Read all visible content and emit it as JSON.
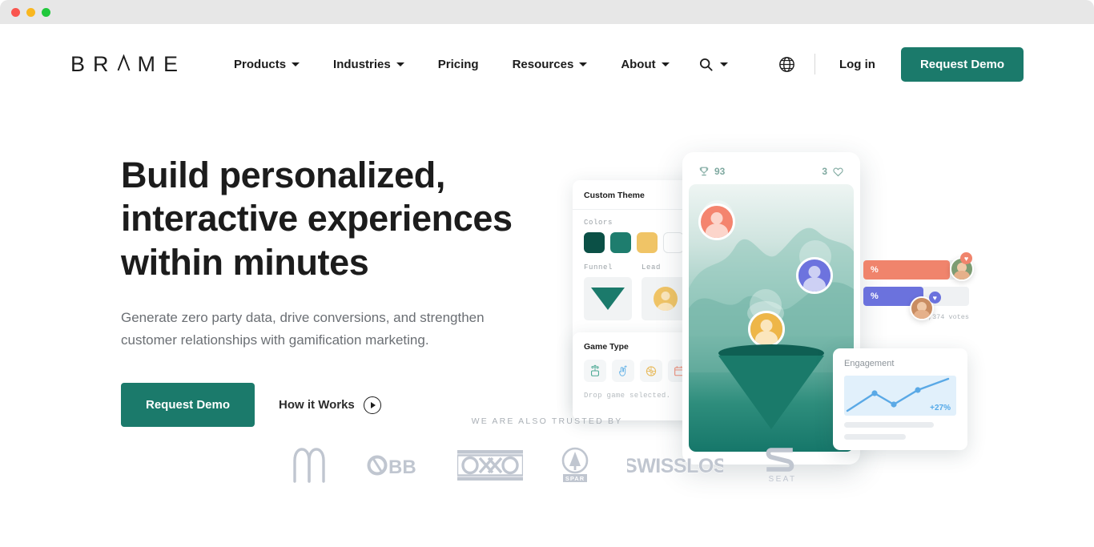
{
  "window": {
    "traffic_lights": [
      "close-red",
      "minimize-amber",
      "maximize-green"
    ]
  },
  "header": {
    "logo": "BRAME",
    "logo_letters": [
      "B",
      "R",
      "A",
      "M",
      "E"
    ],
    "nav": [
      {
        "label": "Products",
        "has_dropdown": true
      },
      {
        "label": "Industries",
        "has_dropdown": true
      },
      {
        "label": "Pricing",
        "has_dropdown": false
      },
      {
        "label": "Resources",
        "has_dropdown": true
      },
      {
        "label": "About",
        "has_dropdown": true
      }
    ],
    "search_icon": "search-icon",
    "globe_icon": "globe-icon",
    "login_label": "Log in",
    "demo_label": "Request Demo"
  },
  "hero": {
    "title": "Build personalized, interactive experiences within minutes",
    "subtitle": "Generate zero party data, drive conversions, and strengthen customer relationships with gamification marketing.",
    "primary_cta": "Request Demo",
    "secondary_cta": "How it Works",
    "play_icon": "play-icon"
  },
  "illustration": {
    "theme_card": {
      "title": "Custom Theme",
      "colors_label": "Colors",
      "swatches": [
        "#0b5046",
        "#1e7d6e",
        "#f0c466",
        "#ffffff"
      ],
      "funnel_label": "Funnel",
      "lead_label": "Lead"
    },
    "game_card": {
      "title": "Game Type",
      "icons": [
        "slot-machine-icon",
        "swipe-hand-icon",
        "wheel-of-fortune-icon",
        "calendar-icon"
      ],
      "note": "Drop game selected."
    },
    "phone": {
      "trophy_icon": "trophy-icon",
      "trophy_count": "93",
      "likes_count": "3",
      "heart_icon": "heart-icon",
      "avatars": [
        "coral",
        "purple",
        "gold"
      ],
      "funnel": "lead-funnel"
    },
    "poll_card": {
      "bars": [
        {
          "color": "#f0846c",
          "value_label": "%"
        },
        {
          "color": "#6b72dd",
          "value_label": "%"
        }
      ],
      "votes_label": "12,374 votes"
    },
    "engagement_card": {
      "title": "Engagement",
      "delta": "+27%",
      "accent": "#54a9e8"
    }
  },
  "trusted": {
    "label": "WE ARE ALSO TRUSTED BY",
    "logos": [
      {
        "name": "mcdonalds-logo",
        "alt": "McDonald's"
      },
      {
        "name": "obb-logo",
        "alt": "ÖBB"
      },
      {
        "name": "oxxo-logo",
        "alt": "OXXO"
      },
      {
        "name": "spar-logo",
        "alt": "SPAR"
      },
      {
        "name": "swisslos-logo",
        "alt": "SWISSLOS"
      },
      {
        "name": "seat-logo",
        "alt": "SEAT"
      }
    ]
  },
  "colors": {
    "brand_green": "#1b7a6b",
    "dark_green": "#0b5046",
    "gold": "#f0c466",
    "coral": "#f0846c",
    "purple": "#6b72dd",
    "text_dark": "#1c1c1c",
    "text_muted": "#6b6f74",
    "logo_gray": "#c0c6d0"
  }
}
